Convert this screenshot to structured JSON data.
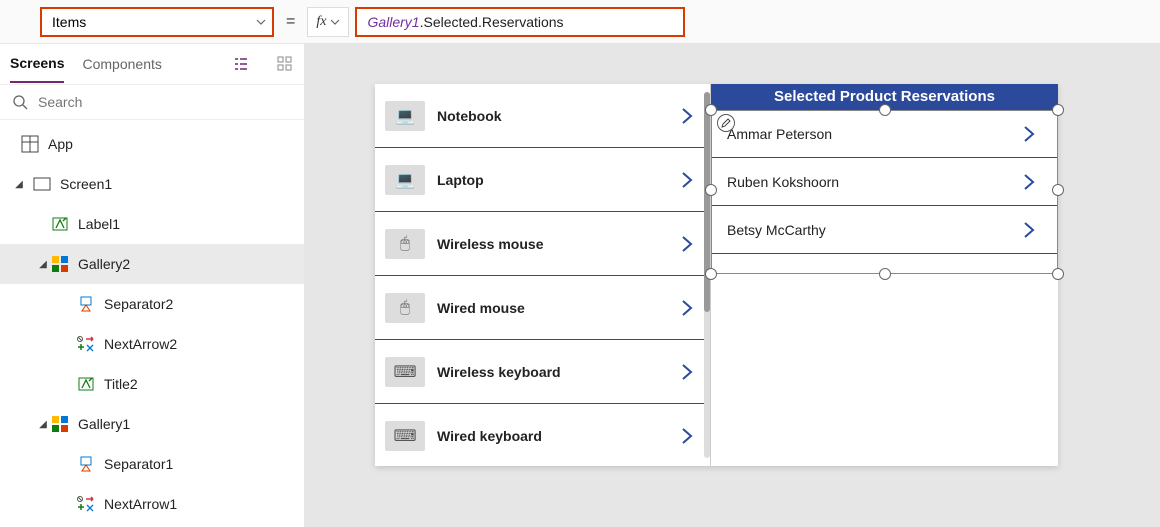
{
  "formula_bar": {
    "property": "Items",
    "equals": "=",
    "fx_label": "fx",
    "tok_gallery": "Gallery1",
    "tok_rest": ".Selected.Reservations"
  },
  "tree": {
    "tab_screens": "Screens",
    "tab_components": "Components",
    "search_placeholder": "Search",
    "app": "App",
    "screen1": "Screen1",
    "label1": "Label1",
    "gallery2": "Gallery2",
    "separator2": "Separator2",
    "nextarrow2": "NextArrow2",
    "title2": "Title2",
    "gallery1": "Gallery1",
    "separator1": "Separator1",
    "nextarrow1": "NextArrow1"
  },
  "canvas": {
    "gallery1_items": [
      {
        "label": "Notebook",
        "glyph": "💻"
      },
      {
        "label": "Laptop",
        "glyph": "💻"
      },
      {
        "label": "Wireless mouse",
        "glyph": "🖱"
      },
      {
        "label": "Wired mouse",
        "glyph": "🖱"
      },
      {
        "label": "Wireless keyboard",
        "glyph": "⌨"
      },
      {
        "label": "Wired keyboard",
        "glyph": "⌨"
      }
    ],
    "gallery2_header": "Selected Product Reservations",
    "gallery2_items": [
      "Ammar Peterson",
      "Ruben Kokshoorn",
      "Betsy McCarthy"
    ]
  }
}
